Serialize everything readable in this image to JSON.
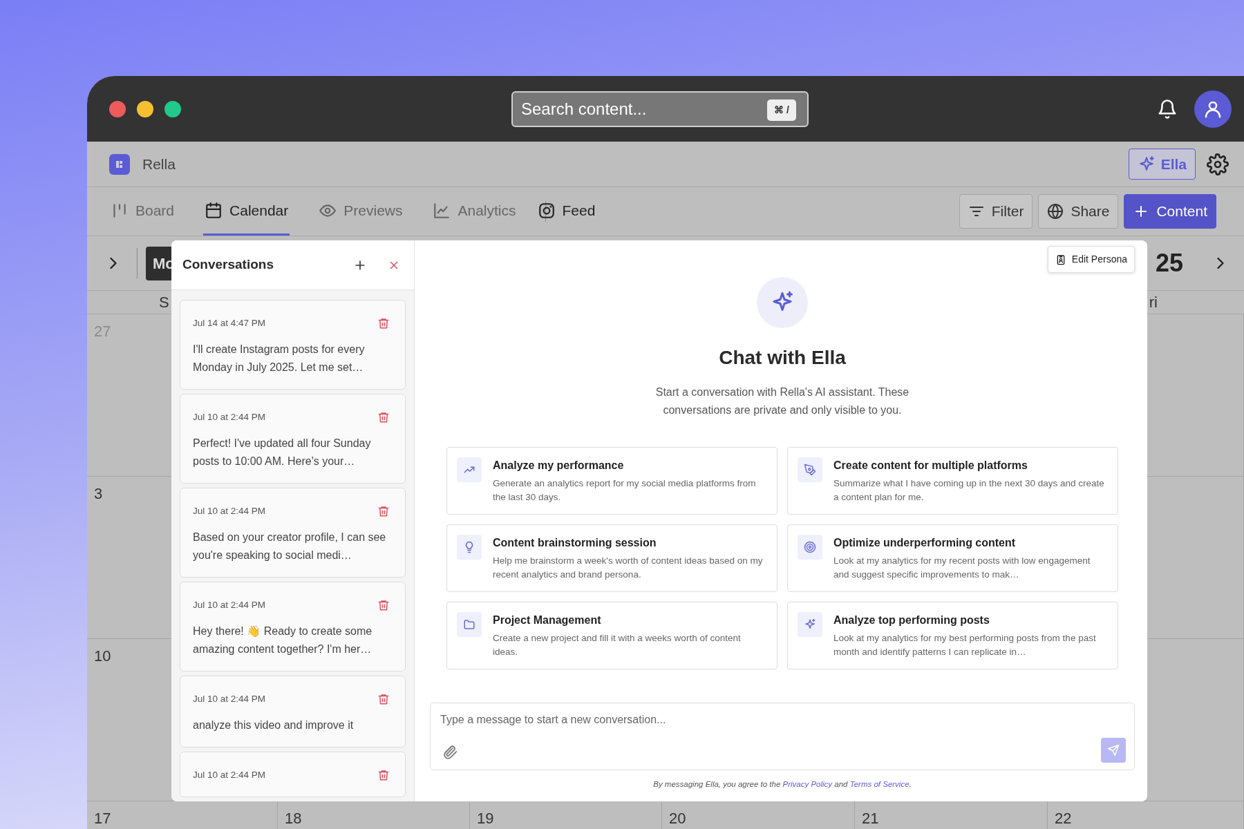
{
  "window": {
    "search": {
      "placeholder": "Search content...",
      "shortcut": "⌘ /"
    }
  },
  "workspace": {
    "name": "Rella",
    "assistant_button": "Ella"
  },
  "tabs": [
    {
      "label": "Board",
      "selected": false,
      "separated": false
    },
    {
      "label": "Calendar",
      "selected": true,
      "separated": false
    },
    {
      "label": "Previews",
      "selected": false,
      "separated": false
    },
    {
      "label": "Analytics",
      "selected": false,
      "separated": false
    },
    {
      "label": "Feed",
      "selected": false,
      "separated": true
    }
  ],
  "toolbar": {
    "buttons": [
      {
        "label": "Filter",
        "kind": "filter"
      },
      {
        "label": "Share",
        "kind": "share"
      },
      {
        "label": "Content",
        "kind": "primary"
      }
    ]
  },
  "calendar": {
    "view_button": "Mo",
    "year": "25",
    "weekday_left": "S",
    "weekday_right": "ri",
    "first_column_days": [
      "27",
      "3",
      "10"
    ],
    "last_row_days": [
      "17",
      "18",
      "19",
      "20",
      "21",
      "22"
    ]
  },
  "conversations": {
    "title": "Conversations",
    "items": [
      {
        "time": "Jul 14 at 4:47 PM",
        "preview": "I'll create Instagram posts for every Monday in July 2025. Let me set…"
      },
      {
        "time": "Jul 10 at 2:44 PM",
        "preview": "Perfect! I've updated all four Sunday posts to 10:00 AM. Here's your…"
      },
      {
        "time": "Jul 10 at 2:44 PM",
        "preview": "Based on your creator profile, I can see you're speaking to social medi…"
      },
      {
        "time": "Jul 10 at 2:44 PM",
        "preview": "Hey there! 👋 Ready to create some amazing content together? I'm her…"
      },
      {
        "time": "Jul 10 at 2:44 PM",
        "preview": "analyze this video and improve it"
      },
      {
        "time": "Jul 10 at 2:44 PM"
      }
    ]
  },
  "chat": {
    "edit_persona": "Edit Persona",
    "heading": "Chat with Ella",
    "intro": "Start a conversation with Rella's AI assistant. These conversations are private and only visible to you.",
    "suggestions": [
      {
        "title": "Analyze my performance",
        "description": "Generate an analytics report for my social media platforms from the last 30 days."
      },
      {
        "title": "Create content for multiple platforms",
        "description": "Summarize what I have coming up in the next 30 days and create a content plan for me."
      },
      {
        "title": "Content brainstorming session",
        "description": "Help me brainstorm a week's worth of content ideas based on my recent analytics and brand persona."
      },
      {
        "title": "Optimize underperforming content",
        "description": "Look at my analytics for my recent posts with low engagement and suggest specific improvements to mak…"
      },
      {
        "title": "Project Management",
        "description": "Create a new project and fill it with a weeks worth of content ideas."
      },
      {
        "title": "Analyze top performing posts",
        "description": "Look at my analytics for my best performing posts from the past month and identify patterns I can replicate in…"
      }
    ],
    "composer": {
      "placeholder": "Type a message to start a new conversation..."
    },
    "legal": {
      "before": "By messaging Ella, you agree to the",
      "privacy_link": "Privacy Policy",
      "middle": "and",
      "terms_link": "Terms of Service",
      "after": "."
    }
  }
}
